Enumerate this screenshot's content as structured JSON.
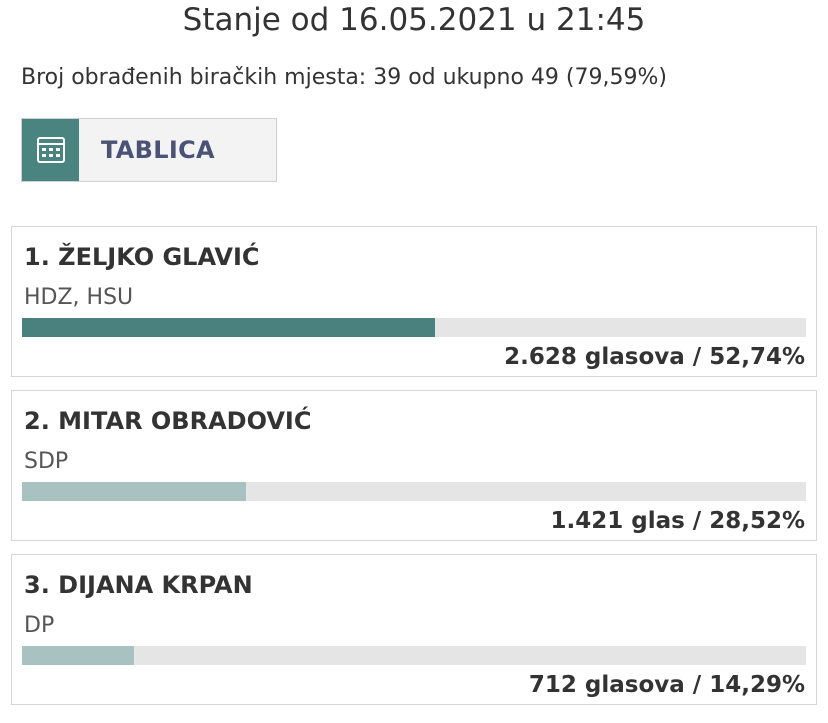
{
  "header": {
    "title": "Stanje od 16.05.2021 u 21:45"
  },
  "summary": {
    "text": "Broj obrađenih biračkih mjesta: 39 od ukupno 49 (79,59%)"
  },
  "view_toggle": {
    "icon": "calendar-grid-icon",
    "label": "TABLICA"
  },
  "colors": {
    "leader_bar": "#4a807d",
    "other_bar": "#a8c2c2",
    "track": "#e5e5e5",
    "icon_bg": "#4a8480"
  },
  "candidates": [
    {
      "name": "1. ŽELJKO GLAVIĆ",
      "party": "HDZ, HSU",
      "share_fraction": 0.5274,
      "result": "2.628 glasova / 52,74%"
    },
    {
      "name": "2. MITAR OBRADOVIĆ",
      "party": "SDP",
      "share_fraction": 0.2852,
      "result": "1.421 glas / 28,52%"
    },
    {
      "name": "3. DIJANA KRPAN",
      "party": "DP",
      "share_fraction": 0.1429,
      "result": "712 glasova / 14,29%"
    }
  ]
}
